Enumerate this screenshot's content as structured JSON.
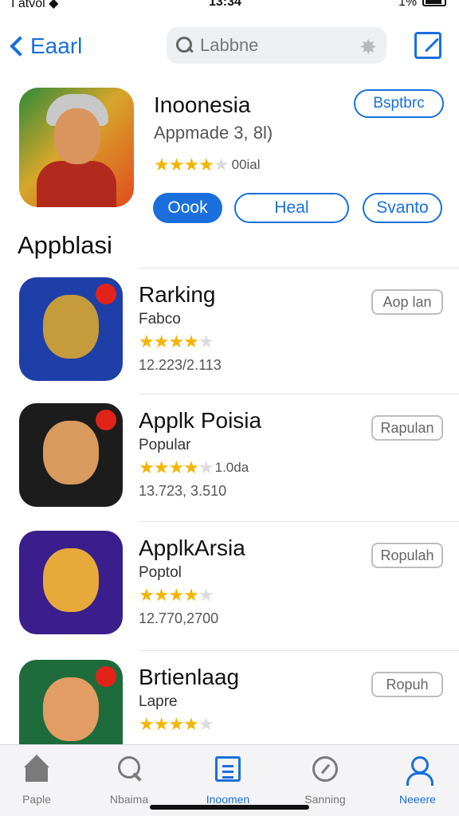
{
  "status_bar": {
    "carrier": "I atvol ◆",
    "time": "13:34",
    "battery_pct": "1%"
  },
  "nav": {
    "back_label": "Eaarl",
    "search_placeholder": "Labbne"
  },
  "featured": {
    "title": "Inoonesia",
    "subtitle": "Appmade 3, 8l)",
    "rating_stars": "★★★★",
    "rating_off": "★",
    "rating_count": "00ial",
    "top_button": "Bsptbrc",
    "pills": [
      "Oook",
      "Heal",
      "Svanto"
    ]
  },
  "section_title": "Appblasi",
  "apps": [
    {
      "name": "Rarking",
      "category": "Fabco",
      "stars": "★★★★",
      "stars_off": "★",
      "rating_count": "",
      "downloads": "12.223/2.113",
      "action": "Aop lan",
      "icon_bg": "#1f3fa8",
      "icon_char": "#c59b3b"
    },
    {
      "name": "Applk Poisia",
      "category": "Popular",
      "stars": "★★★★",
      "stars_off": "★",
      "rating_count": "1.0da",
      "downloads": "13.723, 3.510",
      "action": "Rapulan",
      "icon_bg": "#1c1c1c",
      "icon_char": "#d99a5e"
    },
    {
      "name": "ApplkArsia",
      "category": "Poptol",
      "stars": "★★★★",
      "stars_off": "★",
      "rating_count": "",
      "downloads": "12.770,2700",
      "action": "Ropulah",
      "icon_bg": "#3a1e8c",
      "icon_char": "#e7a93a"
    },
    {
      "name": "Brtienlaag",
      "category": "Lapre",
      "stars": "★★★★",
      "stars_off": "★",
      "rating_count": "",
      "downloads": "",
      "action": "Ropuh",
      "icon_bg": "#1e6b3c",
      "icon_char": "#e39c63"
    }
  ],
  "tabs": [
    {
      "label": "Paple",
      "icon": "home-icon"
    },
    {
      "label": "Nbaima",
      "icon": "search-icon"
    },
    {
      "label": "Inoomen",
      "icon": "document-icon"
    },
    {
      "label": "Sanning",
      "icon": "gauge-icon"
    },
    {
      "label": "Neeere",
      "icon": "person-icon"
    }
  ],
  "colors": {
    "accent": "#1a6fdc",
    "star": "#f3b400"
  }
}
